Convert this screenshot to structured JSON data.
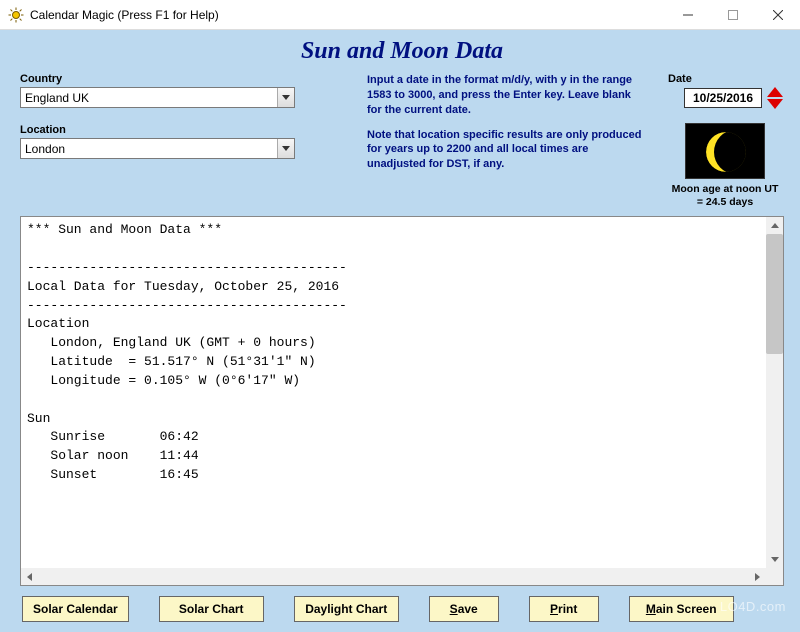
{
  "titlebar": {
    "app_name": "Calendar Magic (Press F1 for Help)"
  },
  "page_title": "Sun and Moon Data",
  "country": {
    "label": "Country",
    "value": "England UK"
  },
  "location": {
    "label": "Location",
    "value": "London"
  },
  "instructions": {
    "p1": "Input a date in the format m/d/y, with y in the range 1583 to 3000, and press the Enter key. Leave blank for the current date.",
    "p2": "Note that location specific results are only produced for years up to 2200 and all local times are unadjusted for DST, if any."
  },
  "date": {
    "label": "Date",
    "value": "10/25/2016"
  },
  "moon": {
    "caption_line1": "Moon age at noon UT",
    "caption_line2": "= 24.5 days"
  },
  "output_text": "*** Sun and Moon Data ***\n\n-----------------------------------------\nLocal Data for Tuesday, October 25, 2016\n-----------------------------------------\nLocation\n   London, England UK (GMT + 0 hours)\n   Latitude  = 51.517° N (51°31'1\" N)\n   Longitude = 0.105° W (0°6'17\" W)\n\nSun\n   Sunrise       06:42\n   Solar noon    11:44\n   Sunset        16:45\n",
  "buttons": {
    "solar_calendar": "Solar Calendar",
    "solar_chart": "Solar Chart",
    "daylight_chart": "Daylight Chart",
    "save": "ave",
    "save_ul": "S",
    "print": "rint",
    "print_ul": "P",
    "main_screen": "ain Screen",
    "main_screen_ul": "M"
  },
  "watermark": "LO4D.com"
}
